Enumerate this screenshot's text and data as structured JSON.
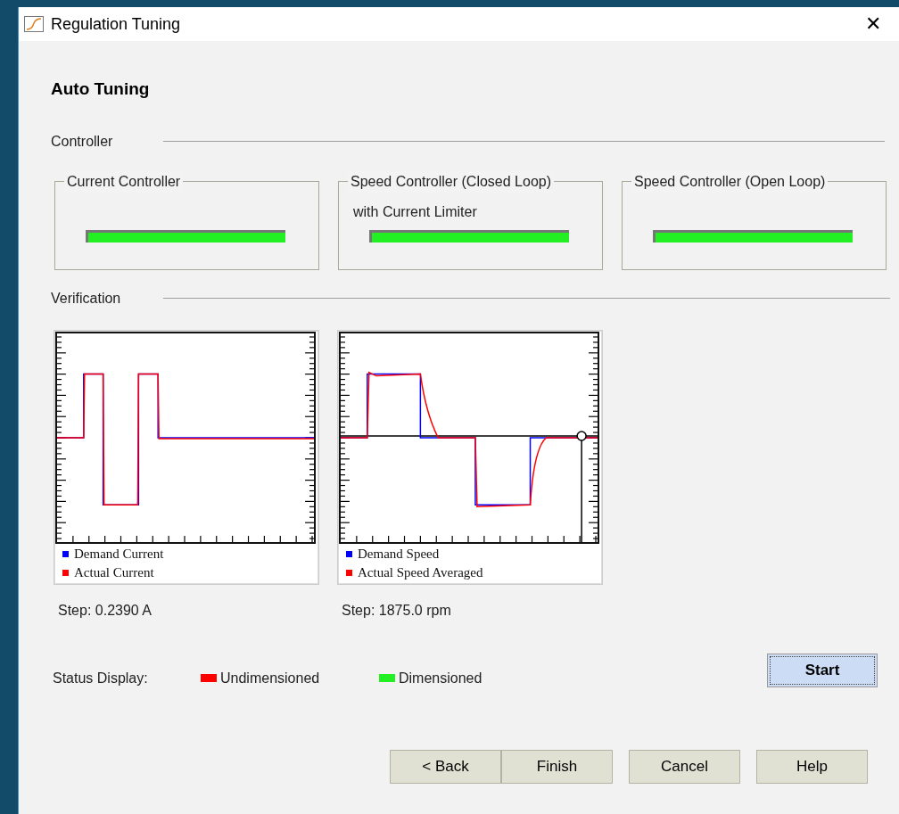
{
  "window": {
    "title": "Regulation Tuning",
    "close": "✕"
  },
  "heading": "Auto Tuning",
  "controller_section": {
    "title": "Controller",
    "groups": [
      {
        "title": "Current Controller",
        "color": "#22f022"
      },
      {
        "title": "Speed Controller (Closed Loop)",
        "subtitle": "with Current Limiter",
        "color": "#22f022"
      },
      {
        "title": "Speed Controller (Open Loop)",
        "color": "#22f022"
      }
    ]
  },
  "verification": {
    "title": "Verification",
    "plots": [
      {
        "kind": "current",
        "legend": [
          {
            "label": "Demand Current",
            "color": "#0000ff"
          },
          {
            "label": "Actual Current",
            "color": "#ff0000"
          }
        ],
        "step": "Step: 0.2390 A"
      },
      {
        "kind": "speed",
        "legend": [
          {
            "label": "Demand Speed",
            "color": "#0000ff"
          },
          {
            "label": "Actual Speed Averaged",
            "color": "#ff0000"
          }
        ],
        "step": "Step: 1875.0 rpm"
      }
    ]
  },
  "status_display": {
    "label": "Status Display:",
    "items": [
      {
        "label": "Undimensioned",
        "color": "#ff0000"
      },
      {
        "label": "Dimensioned",
        "color": "#22f022"
      }
    ]
  },
  "start_button": "Start",
  "buttons": [
    "< Back",
    "Finish",
    "Cancel",
    "Help"
  ]
}
